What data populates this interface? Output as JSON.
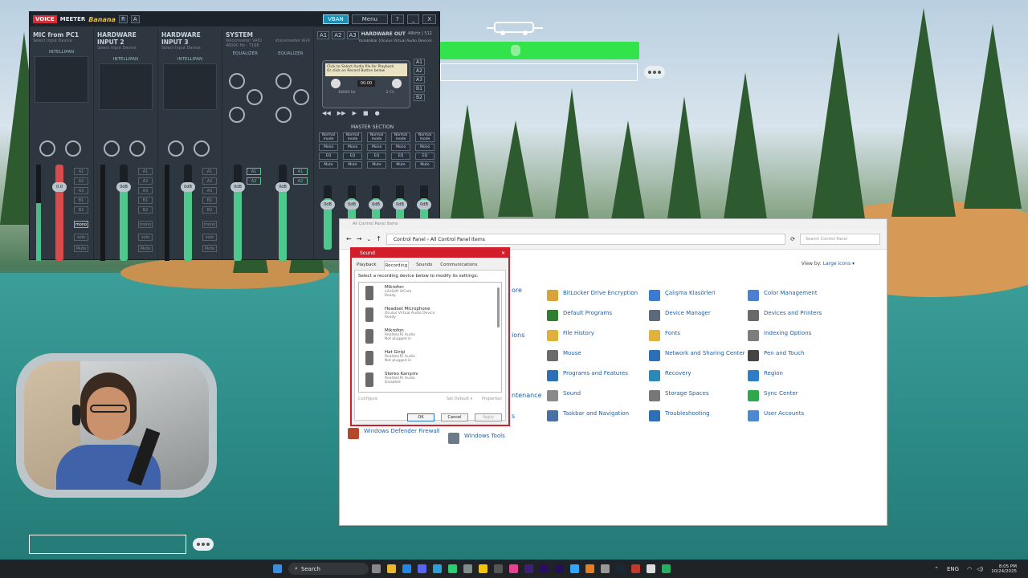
{
  "voicemeeter": {
    "logo_voice": "VOICE",
    "logo_meeter": "MEETER",
    "logo_banana": "Banana",
    "logo_r": "R",
    "logo_a": "A",
    "vban": "VBAN",
    "menu": "Menu",
    "help": "?",
    "minimize": "_",
    "close": "X",
    "strips": [
      {
        "title": "MIC from PC1",
        "sub": "Select Input Device",
        "intellipan": "INTELLIPAN",
        "voice": "VOICE",
        "color_panel": "Color Panel",
        "fx": "fx echo",
        "brightness": "brightness",
        "comp": "Comp.",
        "audibility": "AUDIBILITY",
        "gate": "Gate",
        "gain": "0.0",
        "label": "MIC from PC1"
      },
      {
        "title": "HARDWARE INPUT 2",
        "sub": "Select Input Device",
        "intellipan": "INTELLIPAN",
        "voice": "VOICE",
        "color_panel": "Color Panel",
        "fx": "fx echo",
        "brightness": "brightness",
        "comp": "Comp.",
        "audibility": "AUDIBILITY",
        "gate": "Gate",
        "gain": "0dB",
        "label": "Fader Gain"
      },
      {
        "title": "HARDWARE INPUT 3",
        "sub": "Select Input Device",
        "intellipan": "INTELLIPAN",
        "voice": "VOICE",
        "color_panel": "Color Panel",
        "fx": "fx echo",
        "brightness": "brightness",
        "comp": "Comp.",
        "audibility": "AUDIBILITY",
        "gate": "Gate",
        "gain": "0dB",
        "label": "Fader Gain"
      }
    ],
    "system": {
      "title": "SYSTEM",
      "sub1": "Voicemeeter VAIO",
      "sub2": "Voicemeeter AUX",
      "rate": "48000 Hz - 7168",
      "equalizer": "EQUALIZER",
      "treble": "Treble",
      "bass": "Bass",
      "eq_val": "0.0",
      "fresh": "Fresh",
      "fx_in": "Fx",
      "gain": "0dB",
      "label1": "SYSTEM",
      "label2": "Fader Gain"
    },
    "hardware_out": {
      "label": "HARDWARE OUT",
      "rate": "48kHz | 512",
      "device": "Kulaklıklar (Oculus Virtual Audio Device)"
    },
    "bus_buttons": [
      "A1",
      "A2",
      "A3",
      "B1",
      "B2"
    ],
    "strip_buttons": [
      "mono",
      "solo",
      "Mute"
    ],
    "cassette": {
      "hint1": "Click to Select Audio file for Playback",
      "hint2": "Or click on Record Button below",
      "time": "00:00",
      "rate": "48000 Hz",
      "ch": "2 Ch"
    },
    "master": {
      "label": "MASTER SECTION",
      "mode": "Normal mode",
      "buttons": [
        "Mono",
        "EQ",
        "Mute"
      ],
      "gain": "0dB",
      "fader_label": "Fader Gain"
    }
  },
  "overlay": {
    "webcam_alt": "streamer webcam",
    "chat_icon": "chat"
  },
  "control_panel": {
    "title": "All Control Panel Items",
    "breadcrumb": [
      "Control Panel",
      "All Control Panel Items"
    ],
    "search_placeholder": "Search Control Panel",
    "view_by": "View by:",
    "view_by_value": "Large icons",
    "items": [
      {
        "label": "BitLocker Drive Encryption",
        "color": "#d8a33a"
      },
      {
        "label": "Çalışma Klasörleri",
        "color": "#3a7bd5"
      },
      {
        "label": "Color Management",
        "color": "#4b7fd1"
      },
      {
        "label": "Default Programs",
        "color": "#2f7d2f"
      },
      {
        "label": "Device Manager",
        "color": "#5a6a7a"
      },
      {
        "label": "Devices and Printers",
        "color": "#6a6a6a"
      },
      {
        "label": "File History",
        "color": "#e0b13a"
      },
      {
        "label": "Fonts",
        "color": "#e2b23c"
      },
      {
        "label": "Indexing Options",
        "color": "#7d7d7d"
      },
      {
        "label": "Mouse",
        "color": "#6b6b6b"
      },
      {
        "label": "Network and Sharing Center",
        "color": "#2d6fb7"
      },
      {
        "label": "Pen and Touch",
        "color": "#444"
      },
      {
        "label": "Programs and Features",
        "color": "#2d6fb7"
      },
      {
        "label": "Recovery",
        "color": "#2a8ab7"
      },
      {
        "label": "Region",
        "color": "#2f7dc7"
      },
      {
        "label": "Sound",
        "color": "#8a8a8a"
      },
      {
        "label": "Storage Spaces",
        "color": "#777"
      },
      {
        "label": "Sync Center",
        "color": "#2ea84c"
      },
      {
        "label": "Taskbar and Navigation",
        "color": "#4a6fa5"
      },
      {
        "label": "Troubleshooting",
        "color": "#2d6fb7"
      },
      {
        "label": "User Accounts",
        "color": "#4b8ad1"
      },
      {
        "label": "Windows Defender Firewall",
        "color": "#b5472a"
      },
      {
        "label": "Windows Tools",
        "color": "#6c7a88"
      }
    ],
    "partial_left": [
      "ore",
      "ions",
      "ntenance",
      "s"
    ]
  },
  "sound_dialog": {
    "title": "Sound",
    "tabs": [
      "Playback",
      "Recording",
      "Sounds",
      "Communications"
    ],
    "active_tab": "Recording",
    "hint": "Select a recording device below to modify its settings:",
    "devices": [
      {
        "name": "Mikrofon",
        "driver": "e2eSoft iVCam",
        "status": "Ready"
      },
      {
        "name": "Headset Microphone",
        "driver": "Oculus Virtual Audio Device",
        "status": "Ready"
      },
      {
        "name": "Mikrofon",
        "driver": "Realtek(R) Audio",
        "status": "Not plugged in"
      },
      {
        "name": "Hat Girişi",
        "driver": "Realtek(R) Audio",
        "status": "Not plugged in"
      },
      {
        "name": "Stereo Karışımı",
        "driver": "Realtek(R) Audio",
        "status": "Disabled"
      }
    ],
    "configure": "Configure",
    "set_default": "Set Default",
    "properties": "Properties",
    "ok": "OK",
    "cancel": "Cancel",
    "apply": "Apply"
  },
  "taskbar": {
    "search": "Search",
    "lang": "ENG",
    "time": "8:05 PM",
    "date": "10/24/2025"
  }
}
